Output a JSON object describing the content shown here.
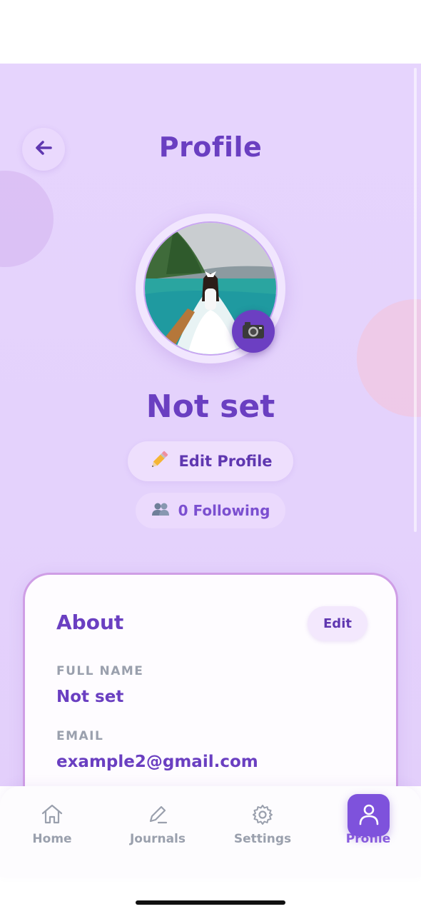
{
  "header": {
    "title": "Profile",
    "back_icon": "arrow-left-icon"
  },
  "profile": {
    "name": "Not set",
    "avatar_icon": "profile-photo",
    "camera_icon": "camera-icon",
    "edit_profile_label": "Edit Profile",
    "edit_profile_icon": "pencil-icon",
    "following_label": "0 Following",
    "following_icon": "people-icon"
  },
  "about": {
    "title": "About",
    "edit_label": "Edit",
    "fields": [
      {
        "label": "FULL NAME",
        "value": "Not set"
      },
      {
        "label": "EMAIL",
        "value": "example2@gmail.com"
      }
    ]
  },
  "tabs": [
    {
      "label": "Home",
      "icon": "home-icon",
      "active": false
    },
    {
      "label": "Journals",
      "icon": "pencil-icon",
      "active": false
    },
    {
      "label": "Settings",
      "icon": "gear-icon",
      "active": false
    },
    {
      "label": "Profile",
      "icon": "person-icon",
      "active": true
    }
  ],
  "colors": {
    "accent": "#6a3fc1",
    "background": "#e6d4fd",
    "card": "#fefcff",
    "muted": "#9aa0ad"
  }
}
